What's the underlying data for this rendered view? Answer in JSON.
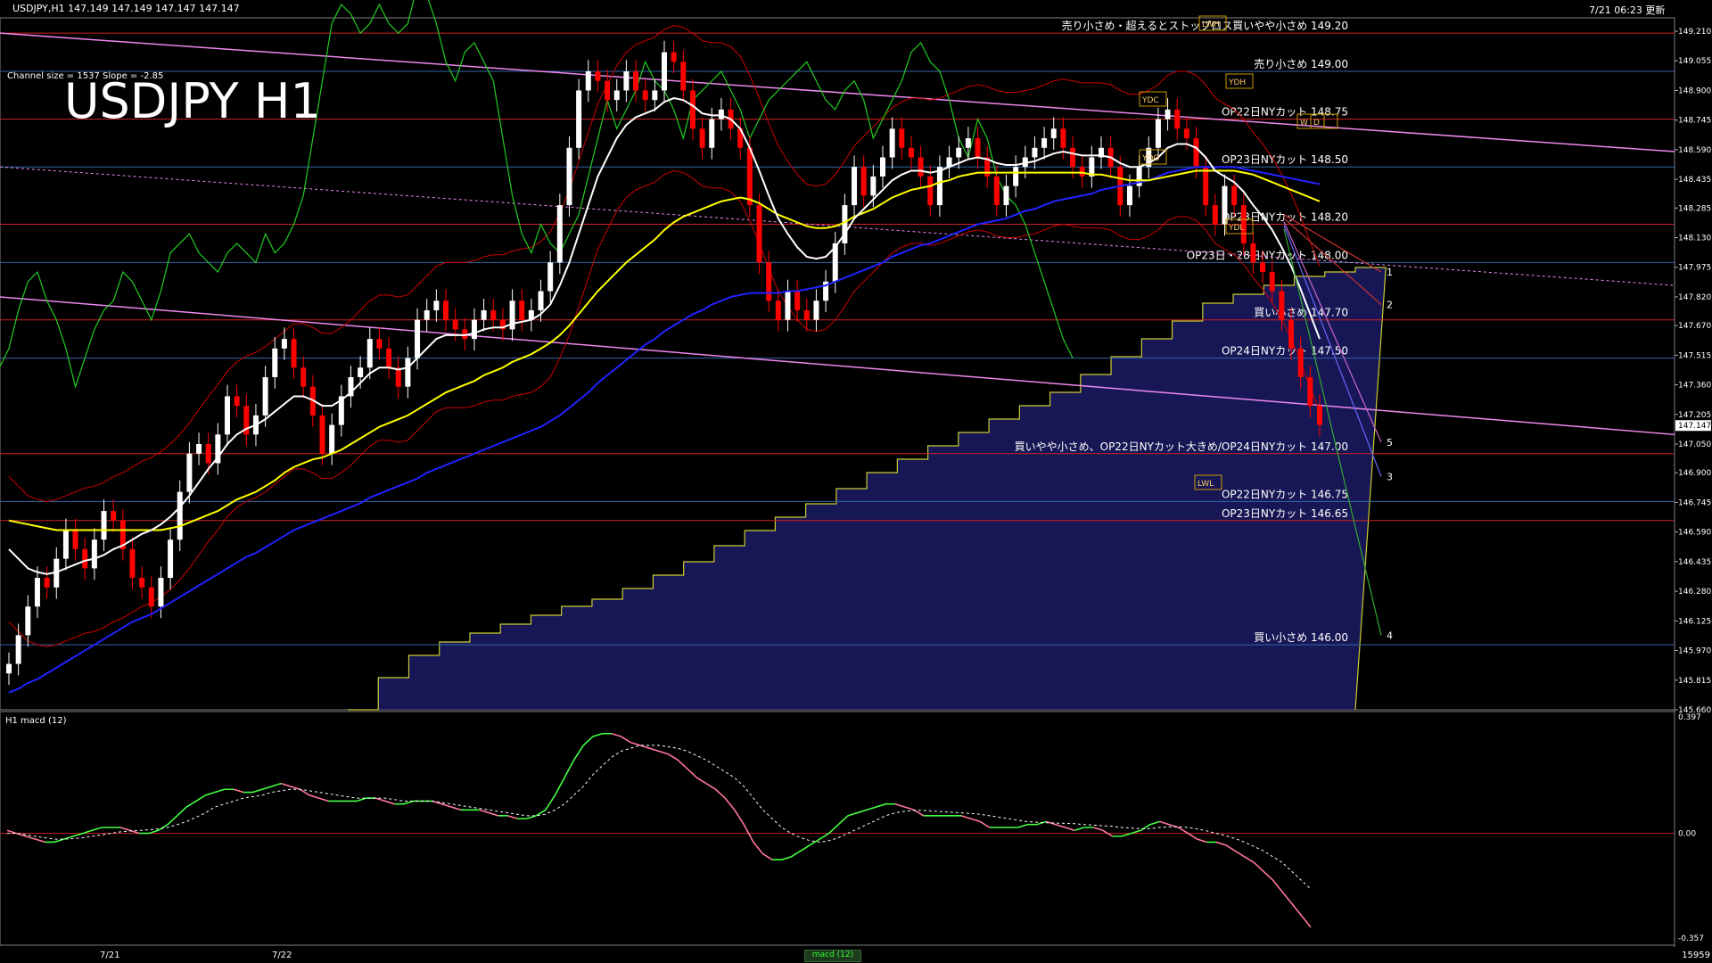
{
  "header": {
    "symbol_line": "USDJPY,H1  147.149 147.149 147.147 147.147",
    "timestamp": "7/21 06:23 更新",
    "title": "USDJPY H1",
    "channel_info": "Channel size = 1537 Slope = -2.85"
  },
  "macd_panel": {
    "title": "H1  macd (12)",
    "axis": [
      "0.397",
      "0.00",
      "-0.357"
    ],
    "button": "macd (12)"
  },
  "bottom": {
    "dates": [
      "7/21",
      "7/22"
    ],
    "corner_value": "15959"
  },
  "colors": {
    "background": "#000000",
    "bull_candle": "#ffffff",
    "bear_candle": "#ff0000",
    "ma_white": "#ffffff",
    "ma_yellow": "#ffff00",
    "ma_blue": "#2222ff",
    "chikou": "#22cc22",
    "bollinger": "#cc0000",
    "channel": "#ee88ee",
    "cloud": "#2a2a9a",
    "cloud_b": "#c08060",
    "level_red": "#cc2222",
    "level_blue": "#3366aa",
    "macd_up": "#44ff44",
    "macd_down": "#ff7799"
  },
  "chart_data": {
    "type": "line",
    "title": "USDJPY H1",
    "price_axis": [
      "149.210",
      "149.055",
      "148.900",
      "148.745",
      "148.590",
      "148.435",
      "148.285",
      "148.130",
      "147.975",
      "147.820",
      "147.670",
      "147.515",
      "147.360",
      "147.205",
      "147.050",
      "146.900",
      "146.745",
      "146.590",
      "146.435",
      "146.280",
      "146.125",
      "145.970",
      "145.815",
      "145.660"
    ],
    "current_price": "147.147",
    "ylim": [
      145.66,
      149.28
    ],
    "order_levels": [
      {
        "price": 149.2,
        "label": "売り小さめ・超えるとストップロス買いやや小さめ 149.20"
      },
      {
        "price": 149.0,
        "label": "売り小さめ 149.00"
      },
      {
        "price": 148.75,
        "label": "OP22日NYカット 148.75"
      },
      {
        "price": 148.5,
        "label": "OP23日NYカット 148.50"
      },
      {
        "price": 148.2,
        "label": "OP23日NYカット 148.20"
      },
      {
        "price": 148.0,
        "label": "OP23日・28日NYカット 148.00"
      },
      {
        "price": 147.7,
        "label": "買い小さめ 147.70"
      },
      {
        "price": 147.5,
        "label": "OP24日NYカット 147.50"
      },
      {
        "price": 147.0,
        "label": "買いやや小さめ、OP22日NYカット大きめ/OP24日NYカット 147.00"
      },
      {
        "price": 146.75,
        "label": "OP22日NYカット 146.75"
      },
      {
        "price": 146.65,
        "label": "OP23日NYカット 146.65"
      },
      {
        "price": 146.0,
        "label": "買い小さめ 146.00"
      }
    ],
    "marker_labels": [
      "LWH",
      "YDH",
      "YDC",
      "YDO",
      "W",
      "D",
      "YDL",
      "LWL"
    ],
    "projection_numbers": [
      "1",
      "2",
      "5",
      "3",
      "4"
    ],
    "close": [
      145.9,
      146.05,
      146.2,
      146.35,
      146.3,
      146.45,
      146.6,
      146.5,
      146.4,
      146.55,
      146.7,
      146.65,
      146.5,
      146.35,
      146.3,
      146.2,
      146.35,
      146.55,
      146.8,
      147.0,
      147.05,
      146.95,
      147.1,
      147.3,
      147.25,
      147.1,
      147.2,
      147.4,
      147.55,
      147.6,
      147.45,
      147.35,
      147.2,
      147.0,
      147.15,
      147.3,
      147.4,
      147.45,
      147.6,
      147.55,
      147.45,
      147.35,
      147.5,
      147.7,
      147.75,
      147.8,
      147.7,
      147.65,
      147.6,
      147.7,
      147.75,
      147.7,
      147.65,
      147.8,
      147.7,
      147.75,
      147.85,
      148.0,
      148.3,
      148.6,
      148.9,
      149.0,
      148.95,
      148.85,
      148.9,
      149.0,
      148.9,
      148.85,
      148.9,
      149.1,
      149.05,
      148.9,
      148.7,
      148.6,
      148.75,
      148.8,
      148.7,
      148.6,
      148.3,
      148.0,
      147.8,
      147.7,
      147.85,
      147.75,
      147.7,
      147.8,
      147.9,
      148.1,
      148.3,
      148.5,
      148.35,
      148.45,
      148.55,
      148.7,
      148.6,
      148.55,
      148.45,
      148.3,
      148.5,
      148.55,
      148.6,
      148.65,
      148.55,
      148.45,
      148.3,
      148.4,
      148.5,
      148.55,
      148.6,
      148.65,
      148.7,
      148.6,
      148.5,
      148.45,
      148.55,
      148.6,
      148.5,
      148.3,
      148.4,
      148.5,
      148.6,
      148.75,
      148.8,
      148.7,
      148.65,
      148.5,
      148.3,
      148.2,
      148.4,
      148.3,
      148.1,
      148.0,
      147.95,
      147.85,
      147.7,
      147.55,
      147.4,
      147.25,
      147.15
    ],
    "ma_white": [
      146.5,
      146.45,
      146.4,
      146.38,
      146.37,
      146.38,
      146.4,
      146.42,
      146.44,
      146.45,
      146.47,
      146.5,
      146.52,
      146.55,
      146.58,
      146.6,
      146.63,
      146.67,
      146.72,
      146.78,
      146.85,
      146.92,
      146.98,
      147.05,
      147.1,
      147.13,
      147.15,
      147.18,
      147.22,
      147.26,
      147.3,
      147.3,
      147.28,
      147.25,
      147.25,
      147.28,
      147.32,
      147.37,
      147.42,
      147.45,
      147.45,
      147.44,
      147.45,
      147.5,
      147.55,
      147.6,
      147.62,
      147.62,
      147.62,
      147.63,
      147.65,
      147.66,
      147.66,
      147.68,
      147.69,
      147.7,
      147.73,
      147.78,
      147.88,
      148.0,
      148.15,
      148.3,
      148.45,
      148.55,
      148.65,
      148.72,
      148.76,
      148.78,
      148.8,
      148.84,
      148.86,
      148.85,
      148.82,
      148.78,
      148.77,
      148.77,
      148.75,
      148.7,
      148.6,
      148.48,
      148.35,
      148.23,
      148.15,
      148.08,
      148.03,
      148.02,
      148.03,
      148.08,
      148.15,
      148.23,
      148.28,
      148.33,
      148.38,
      148.43,
      148.46,
      148.48,
      148.48,
      148.47,
      148.48,
      148.5,
      148.52,
      148.54,
      148.55,
      148.54,
      148.52,
      148.51,
      148.51,
      148.52,
      148.53,
      148.55,
      148.57,
      148.58,
      148.57,
      148.56,
      148.56,
      148.56,
      148.55,
      148.52,
      148.5,
      148.5,
      148.52,
      148.55,
      148.6,
      148.62,
      148.62,
      148.6,
      148.55,
      148.48,
      148.45,
      148.42,
      148.37,
      148.3,
      148.24,
      148.17,
      148.08,
      147.98,
      147.86,
      147.73,
      147.6
    ],
    "ma_yellow": [
      146.65,
      146.64,
      146.63,
      146.62,
      146.61,
      146.6,
      146.6,
      146.6,
      146.6,
      146.6,
      146.6,
      146.6,
      146.6,
      146.6,
      146.6,
      146.6,
      146.6,
      146.61,
      146.62,
      146.64,
      146.66,
      146.68,
      146.7,
      146.73,
      146.76,
      146.78,
      146.8,
      146.83,
      146.86,
      146.9,
      146.93,
      146.95,
      146.97,
      146.98,
      147.0,
      147.02,
      147.05,
      147.08,
      147.11,
      147.14,
      147.16,
      147.18,
      147.2,
      147.23,
      147.26,
      147.29,
      147.32,
      147.34,
      147.36,
      147.38,
      147.41,
      147.43,
      147.45,
      147.48,
      147.5,
      147.52,
      147.55,
      147.58,
      147.62,
      147.67,
      147.73,
      147.79,
      147.85,
      147.9,
      147.95,
      148.0,
      148.04,
      148.08,
      148.12,
      148.17,
      148.21,
      148.24,
      148.26,
      148.28,
      148.3,
      148.32,
      148.33,
      148.34,
      148.33,
      148.31,
      148.28,
      148.25,
      148.23,
      148.21,
      148.19,
      148.18,
      148.18,
      148.19,
      148.21,
      148.24,
      148.26,
      148.28,
      148.31,
      148.34,
      148.36,
      148.38,
      148.39,
      148.4,
      148.42,
      148.43,
      148.45,
      148.46,
      148.47,
      148.47,
      148.47,
      148.47,
      148.47,
      148.47,
      148.47,
      148.47,
      148.47,
      148.47,
      148.47,
      148.47,
      148.46,
      148.46,
      148.45,
      148.44,
      148.43,
      148.43,
      148.43,
      148.44,
      148.45,
      148.46,
      148.47,
      148.48,
      148.48,
      148.48,
      148.48,
      148.48,
      148.47,
      148.46,
      148.44,
      148.42,
      148.4,
      148.38,
      148.36,
      148.34,
      148.32
    ],
    "ma_blue": [
      145.75,
      145.77,
      145.8,
      145.82,
      145.85,
      145.88,
      145.91,
      145.94,
      145.97,
      146.0,
      146.03,
      146.06,
      146.09,
      146.12,
      146.14,
      146.16,
      146.19,
      146.22,
      146.25,
      146.28,
      146.31,
      146.34,
      146.37,
      146.4,
      146.43,
      146.46,
      146.48,
      146.51,
      146.54,
      146.57,
      146.6,
      146.62,
      146.64,
      146.66,
      146.68,
      146.7,
      146.72,
      146.74,
      146.77,
      146.79,
      146.81,
      146.83,
      146.85,
      146.87,
      146.9,
      146.92,
      146.94,
      146.96,
      146.98,
      147.0,
      147.02,
      147.04,
      147.06,
      147.08,
      147.1,
      147.12,
      147.14,
      147.17,
      147.2,
      147.24,
      147.28,
      147.32,
      147.37,
      147.41,
      147.45,
      147.49,
      147.53,
      147.57,
      147.6,
      147.64,
      147.67,
      147.7,
      147.73,
      147.75,
      147.78,
      147.8,
      147.82,
      147.83,
      147.84,
      147.84,
      147.84,
      147.84,
      147.85,
      147.85,
      147.86,
      147.87,
      147.88,
      147.9,
      147.92,
      147.94,
      147.96,
      147.98,
      148.0,
      148.03,
      148.05,
      148.07,
      148.09,
      148.1,
      148.12,
      148.14,
      148.16,
      148.18,
      148.2,
      148.21,
      148.22,
      148.23,
      148.25,
      148.27,
      148.28,
      148.3,
      148.32,
      148.33,
      148.34,
      148.35,
      148.36,
      148.38,
      148.39,
      148.4,
      148.41,
      148.42,
      148.43,
      148.45,
      148.47,
      148.48,
      148.49,
      148.5,
      148.5,
      148.5,
      148.5,
      148.5,
      148.49,
      148.48,
      148.47,
      148.46,
      148.45,
      148.44,
      148.43,
      148.42,
      148.41
    ],
    "macd": {
      "axis_labels": [
        "0.397",
        "0.00",
        "-0.357"
      ],
      "ylim": [
        -0.357,
        0.397
      ],
      "main": [
        0.01,
        0.0,
        -0.01,
        -0.02,
        -0.03,
        -0.03,
        -0.02,
        -0.01,
        0.0,
        0.01,
        0.02,
        0.02,
        0.02,
        0.01,
        0.0,
        0.0,
        0.01,
        0.03,
        0.06,
        0.09,
        0.11,
        0.13,
        0.14,
        0.15,
        0.15,
        0.14,
        0.14,
        0.15,
        0.16,
        0.17,
        0.16,
        0.15,
        0.13,
        0.12,
        0.11,
        0.11,
        0.11,
        0.11,
        0.12,
        0.12,
        0.11,
        0.1,
        0.1,
        0.11,
        0.11,
        0.11,
        0.1,
        0.09,
        0.08,
        0.08,
        0.08,
        0.07,
        0.06,
        0.06,
        0.05,
        0.05,
        0.06,
        0.08,
        0.13,
        0.19,
        0.25,
        0.3,
        0.33,
        0.34,
        0.34,
        0.33,
        0.31,
        0.3,
        0.29,
        0.28,
        0.27,
        0.25,
        0.22,
        0.19,
        0.17,
        0.15,
        0.12,
        0.08,
        0.03,
        -0.03,
        -0.07,
        -0.09,
        -0.09,
        -0.08,
        -0.06,
        -0.04,
        -0.02,
        0.0,
        0.03,
        0.06,
        0.07,
        0.08,
        0.09,
        0.1,
        0.1,
        0.09,
        0.08,
        0.06,
        0.06,
        0.06,
        0.06,
        0.06,
        0.05,
        0.04,
        0.02,
        0.02,
        0.02,
        0.02,
        0.03,
        0.03,
        0.04,
        0.03,
        0.02,
        0.01,
        0.02,
        0.02,
        0.01,
        -0.01,
        -0.01,
        0.0,
        0.01,
        0.03,
        0.04,
        0.03,
        0.02,
        0.0,
        -0.02,
        -0.03,
        -0.03,
        -0.04,
        -0.06,
        -0.08,
        -0.1,
        -0.13,
        -0.16,
        -0.2,
        -0.24,
        -0.28,
        -0.32
      ],
      "signal": [
        0.0,
        0.0,
        -0.005,
        -0.01,
        -0.015,
        -0.02,
        -0.02,
        -0.018,
        -0.015,
        -0.01,
        -0.005,
        0.0,
        0.005,
        0.008,
        0.01,
        0.012,
        0.015,
        0.02,
        0.03,
        0.04,
        0.055,
        0.07,
        0.09,
        0.1,
        0.11,
        0.12,
        0.125,
        0.13,
        0.14,
        0.145,
        0.15,
        0.15,
        0.145,
        0.14,
        0.135,
        0.13,
        0.125,
        0.12,
        0.12,
        0.12,
        0.12,
        0.115,
        0.11,
        0.11,
        0.11,
        0.11,
        0.105,
        0.1,
        0.095,
        0.09,
        0.085,
        0.08,
        0.075,
        0.07,
        0.065,
        0.06,
        0.06,
        0.065,
        0.08,
        0.1,
        0.13,
        0.16,
        0.2,
        0.23,
        0.26,
        0.28,
        0.29,
        0.3,
        0.3,
        0.3,
        0.295,
        0.29,
        0.28,
        0.265,
        0.25,
        0.23,
        0.21,
        0.19,
        0.16,
        0.12,
        0.08,
        0.05,
        0.02,
        0.0,
        -0.015,
        -0.025,
        -0.03,
        -0.025,
        -0.015,
        0.0,
        0.015,
        0.03,
        0.045,
        0.06,
        0.07,
        0.075,
        0.078,
        0.078,
        0.076,
        0.074,
        0.072,
        0.07,
        0.068,
        0.065,
        0.06,
        0.055,
        0.05,
        0.045,
        0.04,
        0.038,
        0.036,
        0.035,
        0.034,
        0.033,
        0.03,
        0.028,
        0.026,
        0.024,
        0.02,
        0.018,
        0.016,
        0.016,
        0.02,
        0.022,
        0.022,
        0.02,
        0.015,
        0.008,
        0.0,
        -0.008,
        -0.018,
        -0.03,
        -0.045,
        -0.06,
        -0.08,
        -0.1,
        -0.13,
        -0.16,
        -0.19
      ]
    }
  }
}
